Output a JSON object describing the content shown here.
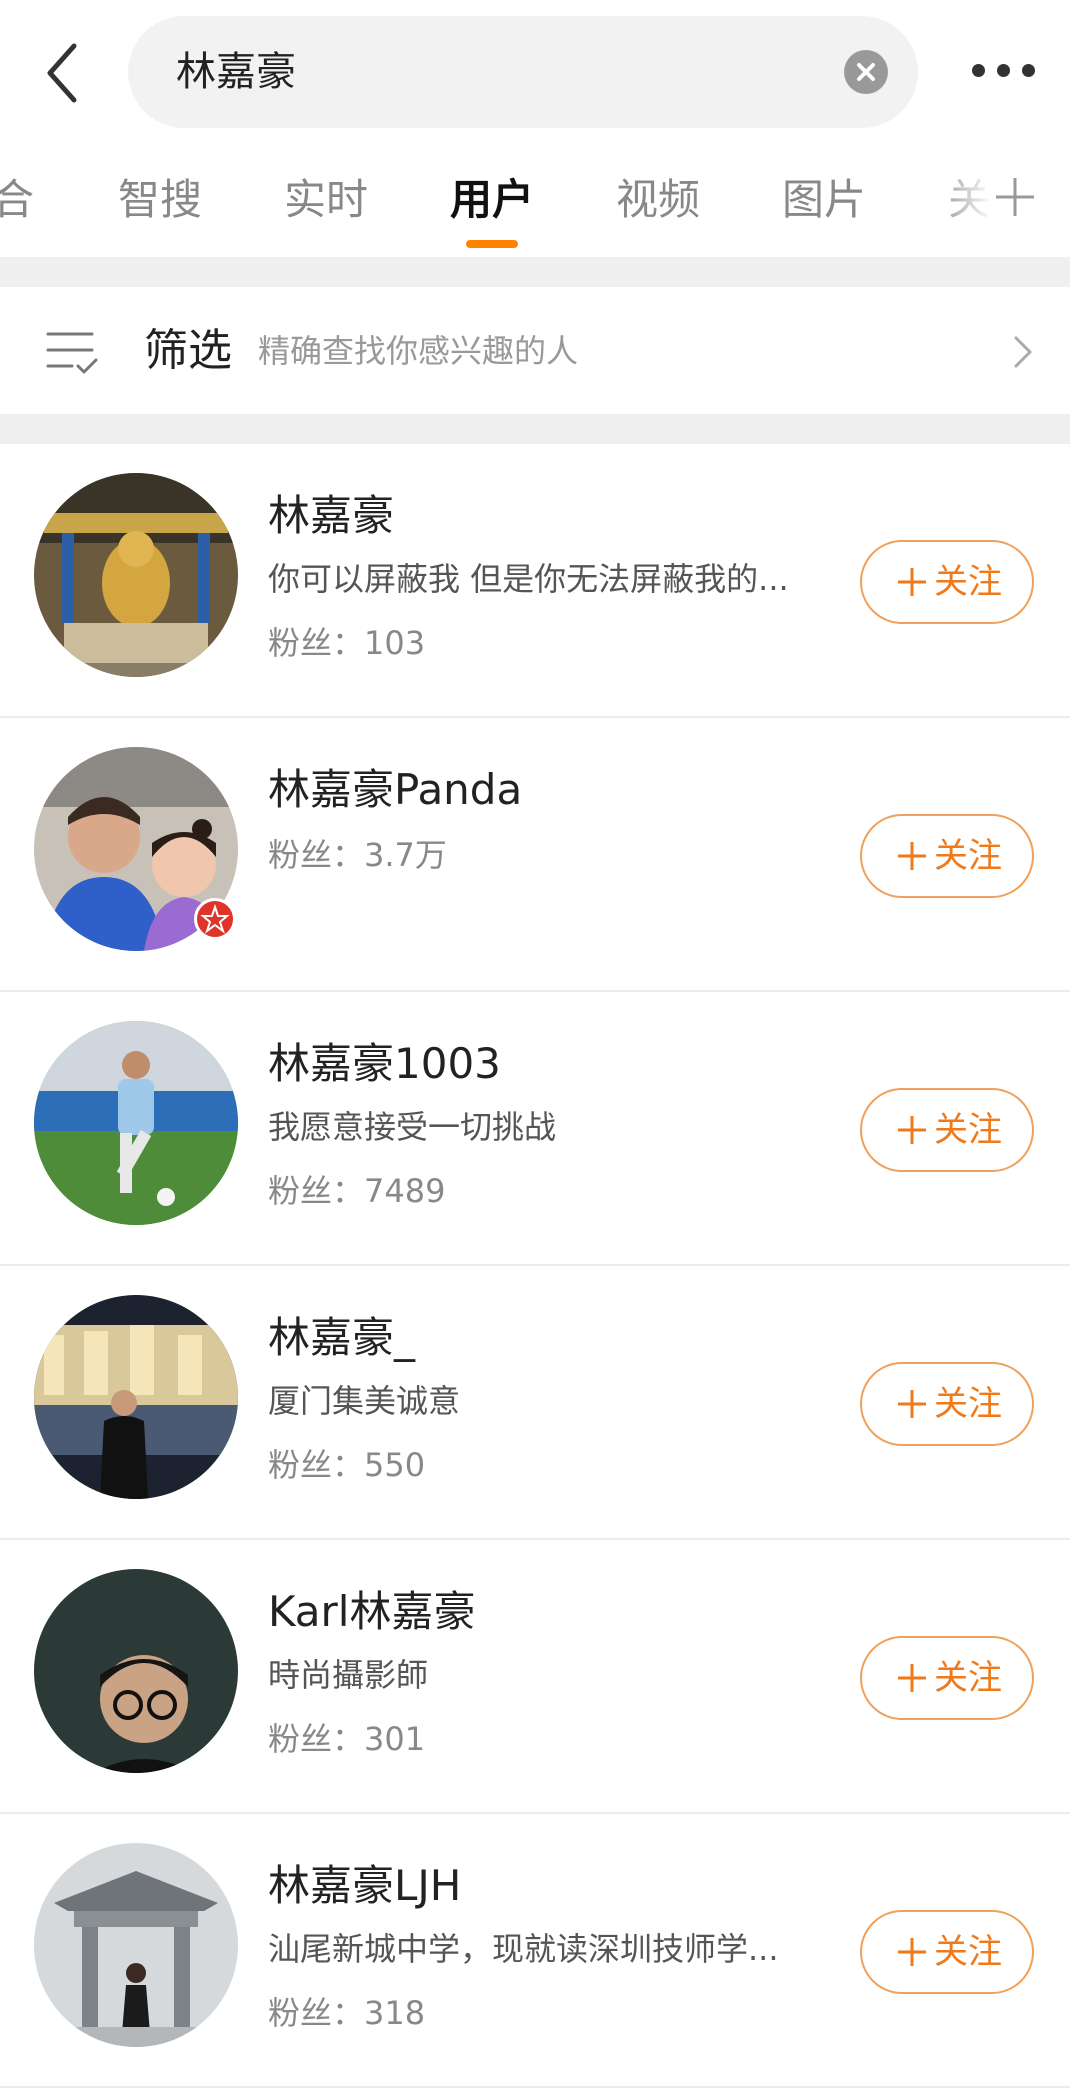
{
  "search": {
    "query": "林嘉豪"
  },
  "tabs": [
    {
      "label": "合"
    },
    {
      "label": "智搜"
    },
    {
      "label": "实时"
    },
    {
      "label": "用户"
    },
    {
      "label": "视频"
    },
    {
      "label": "图片"
    },
    {
      "label": "关"
    }
  ],
  "active_tab_index": 3,
  "filter": {
    "title": "筛选",
    "subtitle": "精确查找你感兴趣的人"
  },
  "follow_label": "关注",
  "fans_label": "粉丝：",
  "users": [
    {
      "name": "林嘉豪",
      "bio": "你可以屏蔽我 但是你无法屏蔽我的...",
      "fans": "103",
      "avatar_icon": "temple-statue-photo",
      "verified": false
    },
    {
      "name": "林嘉豪Panda",
      "bio": "",
      "fans": "3.7万",
      "avatar_icon": "two-people-selfie-photo",
      "verified": true
    },
    {
      "name": "林嘉豪1003",
      "bio": "我愿意接受一切挑战",
      "fans": "7489",
      "avatar_icon": "football-player-photo",
      "verified": false
    },
    {
      "name": "林嘉豪_",
      "bio": "厦门集美诚意",
      "fans": "550",
      "avatar_icon": "night-building-photo",
      "verified": false
    },
    {
      "name": "Karl林嘉豪",
      "bio": "時尚攝影師",
      "fans": "301",
      "avatar_icon": "portrait-glasses-photo",
      "verified": false
    },
    {
      "name": "林嘉豪LJH",
      "bio": "汕尾新城中学，现就读深圳技师学...",
      "fans": "318",
      "avatar_icon": "pavilion-snow-photo",
      "verified": false
    }
  ],
  "colors": {
    "accent": "#ff8200",
    "follow_border": "#f0a05a",
    "follow_text": "#f07a1a",
    "badge": "#e0332a"
  }
}
